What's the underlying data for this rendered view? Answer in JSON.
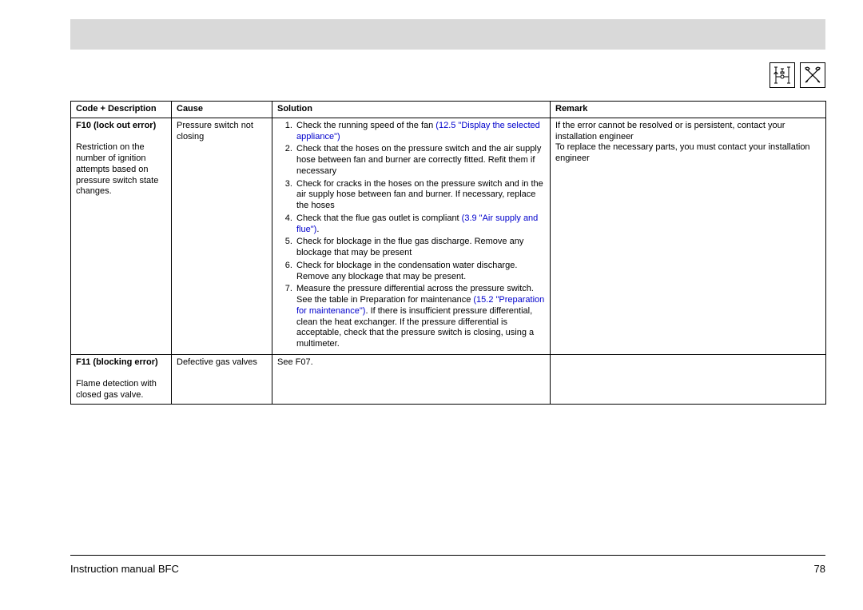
{
  "headers": {
    "code": "Code + Description",
    "cause": "Cause",
    "solution": "Solution",
    "remark": "Remark"
  },
  "row1": {
    "code_title": "F10 (lock out error)",
    "code_desc": "Restriction on the number of ignition attempts based on pressure switch state changes.",
    "cause": "Pressure switch not closing",
    "sol1a": "Check the running speed of the fan ",
    "sol1b": "(12.5 \"Display the selected appliance\")",
    "sol2": "Check that the hoses on the pressure switch and the air supply hose between fan and burner are correctly fitted. Refit them if necessary",
    "sol3": "Check for cracks in the hoses on the pressure switch and in the air supply hose between fan and burner. If necessary, replace the hoses",
    "sol4a": "Check that the flue gas outlet is compliant ",
    "sol4b": "(3.9 \"Air supply and flue\")",
    "sol4c": ".",
    "sol5": "Check for blockage in the flue gas discharge. Remove any blockage that may be present",
    "sol6": "Check for blockage in the condensation water discharge. Remove any blockage that may be present.",
    "sol7a": "Measure the pressure differential across the pressure switch. See the table in Preparation for maintenance ",
    "sol7b": "(15.2 \"Preparation for maintenance\")",
    "sol7c": ". If there is insufficient pressure differential, clean the heat exchanger. If the pressure differential is acceptable, check that the pressure switch is closing, using a multimeter.",
    "remark_line1": "If the error cannot be resolved or is persistent, contact your installation engineer",
    "remark_line2": "To replace the necessary parts, you must contact your installation engineer"
  },
  "row2": {
    "code_title": "F11 (blocking error)",
    "code_desc": "Flame detection with closed gas valve.",
    "cause": "Defective gas valves",
    "solution": "See F07.",
    "remark": ""
  },
  "footer": {
    "left": "Instruction manual BFC",
    "right": "78"
  },
  "icons": {
    "valve": "valve-diagram-icon",
    "tools": "crossed-tools-icon"
  }
}
